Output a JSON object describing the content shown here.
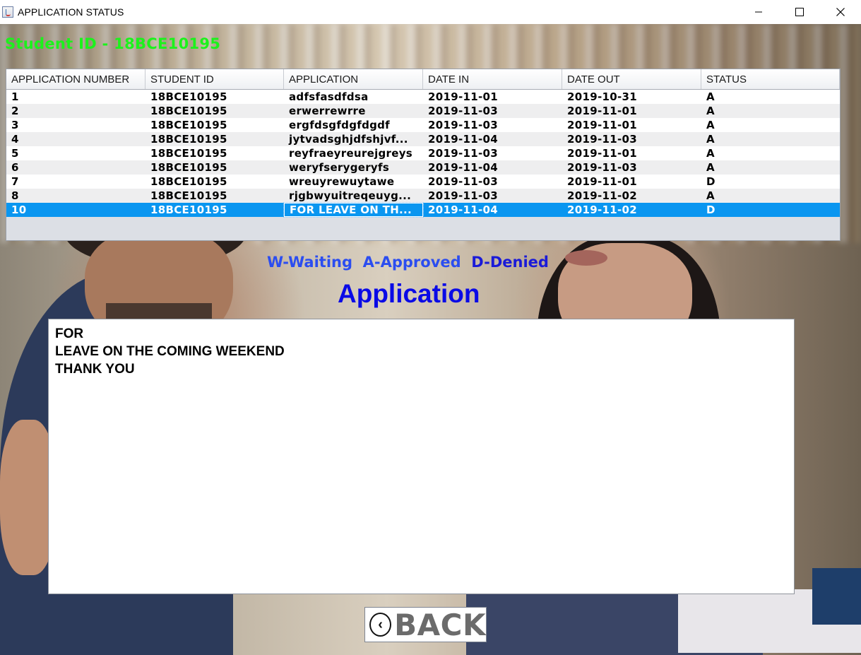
{
  "window": {
    "title": "APPLICATION STATUS"
  },
  "header": {
    "student_label": "Student ID  - 18BCE10195"
  },
  "table": {
    "columns": [
      "APPLICATION NUMBER",
      "STUDENT ID",
      "APPLICATION",
      "DATE IN",
      "DATE OUT",
      "STATUS"
    ],
    "rows": [
      [
        "1",
        "18BCE10195",
        "adfsfasdfdsa",
        "2019-11-01",
        "2019-10-31",
        "A"
      ],
      [
        "2",
        "18BCE10195",
        "erwerrewrre",
        "2019-11-03",
        "2019-11-01",
        "A"
      ],
      [
        "3",
        "18BCE10195",
        "ergfdsgfdgfdgdf",
        "2019-11-03",
        "2019-11-01",
        "A"
      ],
      [
        "4",
        "18BCE10195",
        "jytvadsghjdfshjvf...",
        "2019-11-04",
        "2019-11-03",
        "A"
      ],
      [
        "5",
        "18BCE10195",
        "reyfraeyreurejgreys",
        "2019-11-03",
        "2019-11-01",
        "A"
      ],
      [
        "6",
        "18BCE10195",
        "weryfserygeryfs",
        "2019-11-04",
        "2019-11-03",
        "A"
      ],
      [
        "7",
        "18BCE10195",
        "wreuyrewuytawe",
        "2019-11-03",
        "2019-11-01",
        "D"
      ],
      [
        "8",
        "18BCE10195",
        "rjgbwyuitreqeuyg...",
        "2019-11-03",
        "2019-11-02",
        "A"
      ],
      [
        "10",
        "18BCE10195",
        "FOR LEAVE ON TH...",
        "2019-11-04",
        "2019-11-02",
        "D"
      ]
    ],
    "selected_row": "10"
  },
  "legend": {
    "waiting": "W-Waiting",
    "approved": "A-Approved",
    "denied": "D-Denied"
  },
  "application": {
    "heading": "Application",
    "text": "FOR\nLEAVE ON THE COMING WEEKEND\nTHANK YOU"
  },
  "back_button": {
    "label": "BACK",
    "icon": "chevron-left-circle-icon"
  },
  "colors": {
    "student_label": "#1cf21c",
    "selection": "#0a96f0",
    "heading": "#0a0ae6",
    "legend": "#2b4df0"
  }
}
